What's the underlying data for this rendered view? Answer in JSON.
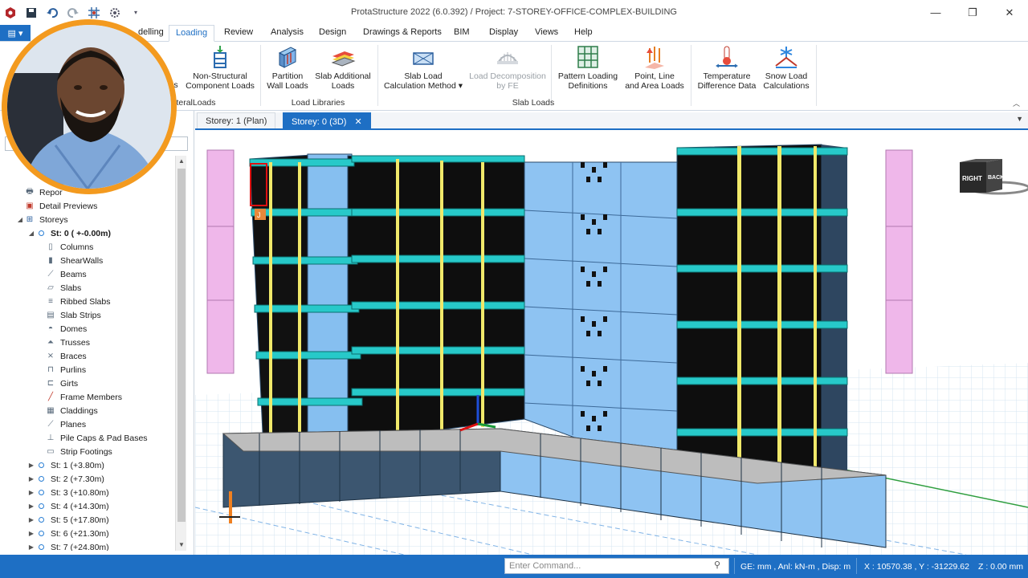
{
  "app": {
    "title": "ProtaStructure 2022 (6.0.392) / Project: 7-STOREY-OFFICE-COMPLEX-BUILDING"
  },
  "window_controls": {
    "minimize": "—",
    "maximize": "❐",
    "close": "✕"
  },
  "menu": {
    "tabs": [
      "delling",
      "Loading",
      "Review",
      "Analysis",
      "Design",
      "Drawings & Reports",
      "BIM",
      "Display",
      "Views",
      "Help"
    ],
    "active": "Loading"
  },
  "ribbon": {
    "buttons": [
      {
        "label1": "Non-Structural",
        "label2": "Component Loads"
      },
      {
        "label1": "Partition",
        "label2": "Wall Loads"
      },
      {
        "label1": "Slab Additional",
        "label2": "Loads"
      },
      {
        "label1": "Slab Load",
        "label2": "Calculation Method ▾"
      },
      {
        "label1": "Load Decomposition",
        "label2": "by FE"
      },
      {
        "label1": "Pattern Loading",
        "label2": "Definitions"
      },
      {
        "label1": "Point, Line",
        "label2": "and Area Loads"
      },
      {
        "label1": "Temperature",
        "label2": "Difference Data"
      },
      {
        "label1": "Snow Load",
        "label2": "Calculations"
      }
    ],
    "groups": [
      "teralLoads",
      "Load Libraries",
      "Slab Loads"
    ],
    "partial_left": "s"
  },
  "tree": {
    "items": [
      {
        "label": "Repor",
        "icon": "printer-icon"
      },
      {
        "label": "Detail Previews",
        "icon": "preview-icon"
      },
      {
        "label": "Storeys",
        "icon": "storeys-icon"
      },
      {
        "label": "St: 0 ( +-0.00m)"
      },
      {
        "label": "Columns"
      },
      {
        "label": "ShearWalls"
      },
      {
        "label": "Beams"
      },
      {
        "label": "Slabs"
      },
      {
        "label": "Ribbed Slabs"
      },
      {
        "label": "Slab Strips"
      },
      {
        "label": "Domes"
      },
      {
        "label": "Trusses"
      },
      {
        "label": "Braces"
      },
      {
        "label": "Purlins"
      },
      {
        "label": "Girts"
      },
      {
        "label": "Frame Members"
      },
      {
        "label": "Claddings"
      },
      {
        "label": "Planes"
      },
      {
        "label": "Pile Caps & Pad Bases"
      },
      {
        "label": "Strip Footings"
      },
      {
        "label": "St: 1 (+3.80m)"
      },
      {
        "label": "St: 2 (+7.30m)"
      },
      {
        "label": "St: 3 (+10.80m)"
      },
      {
        "label": "St: 4 (+14.30m)"
      },
      {
        "label": "St: 5 (+17.80m)"
      },
      {
        "label": "St: 6 (+21.30m)"
      },
      {
        "label": "St: 7 (+24.80m)"
      }
    ]
  },
  "doc_tabs": [
    "Storey: 1 (Plan)",
    "Storey: 0 (3D)"
  ],
  "view": {
    "navcube": {
      "right": "RIGHT",
      "back": "BACK"
    },
    "marker": "J"
  },
  "status": {
    "command_placeholder": "Enter Command...",
    "units": "GE: mm , Anl: kN-m , Disp: m",
    "coords": "X : 10570.38 , Y : -31229.62",
    "z": "Z : 0.00 mm"
  },
  "colors": {
    "accent": "#1e6fc4",
    "avatar_ring": "#f39a1f",
    "panel_blue": "#8ec3f2",
    "beam_cyan": "#27c9c9",
    "column_yellow": "#f0e86a"
  }
}
